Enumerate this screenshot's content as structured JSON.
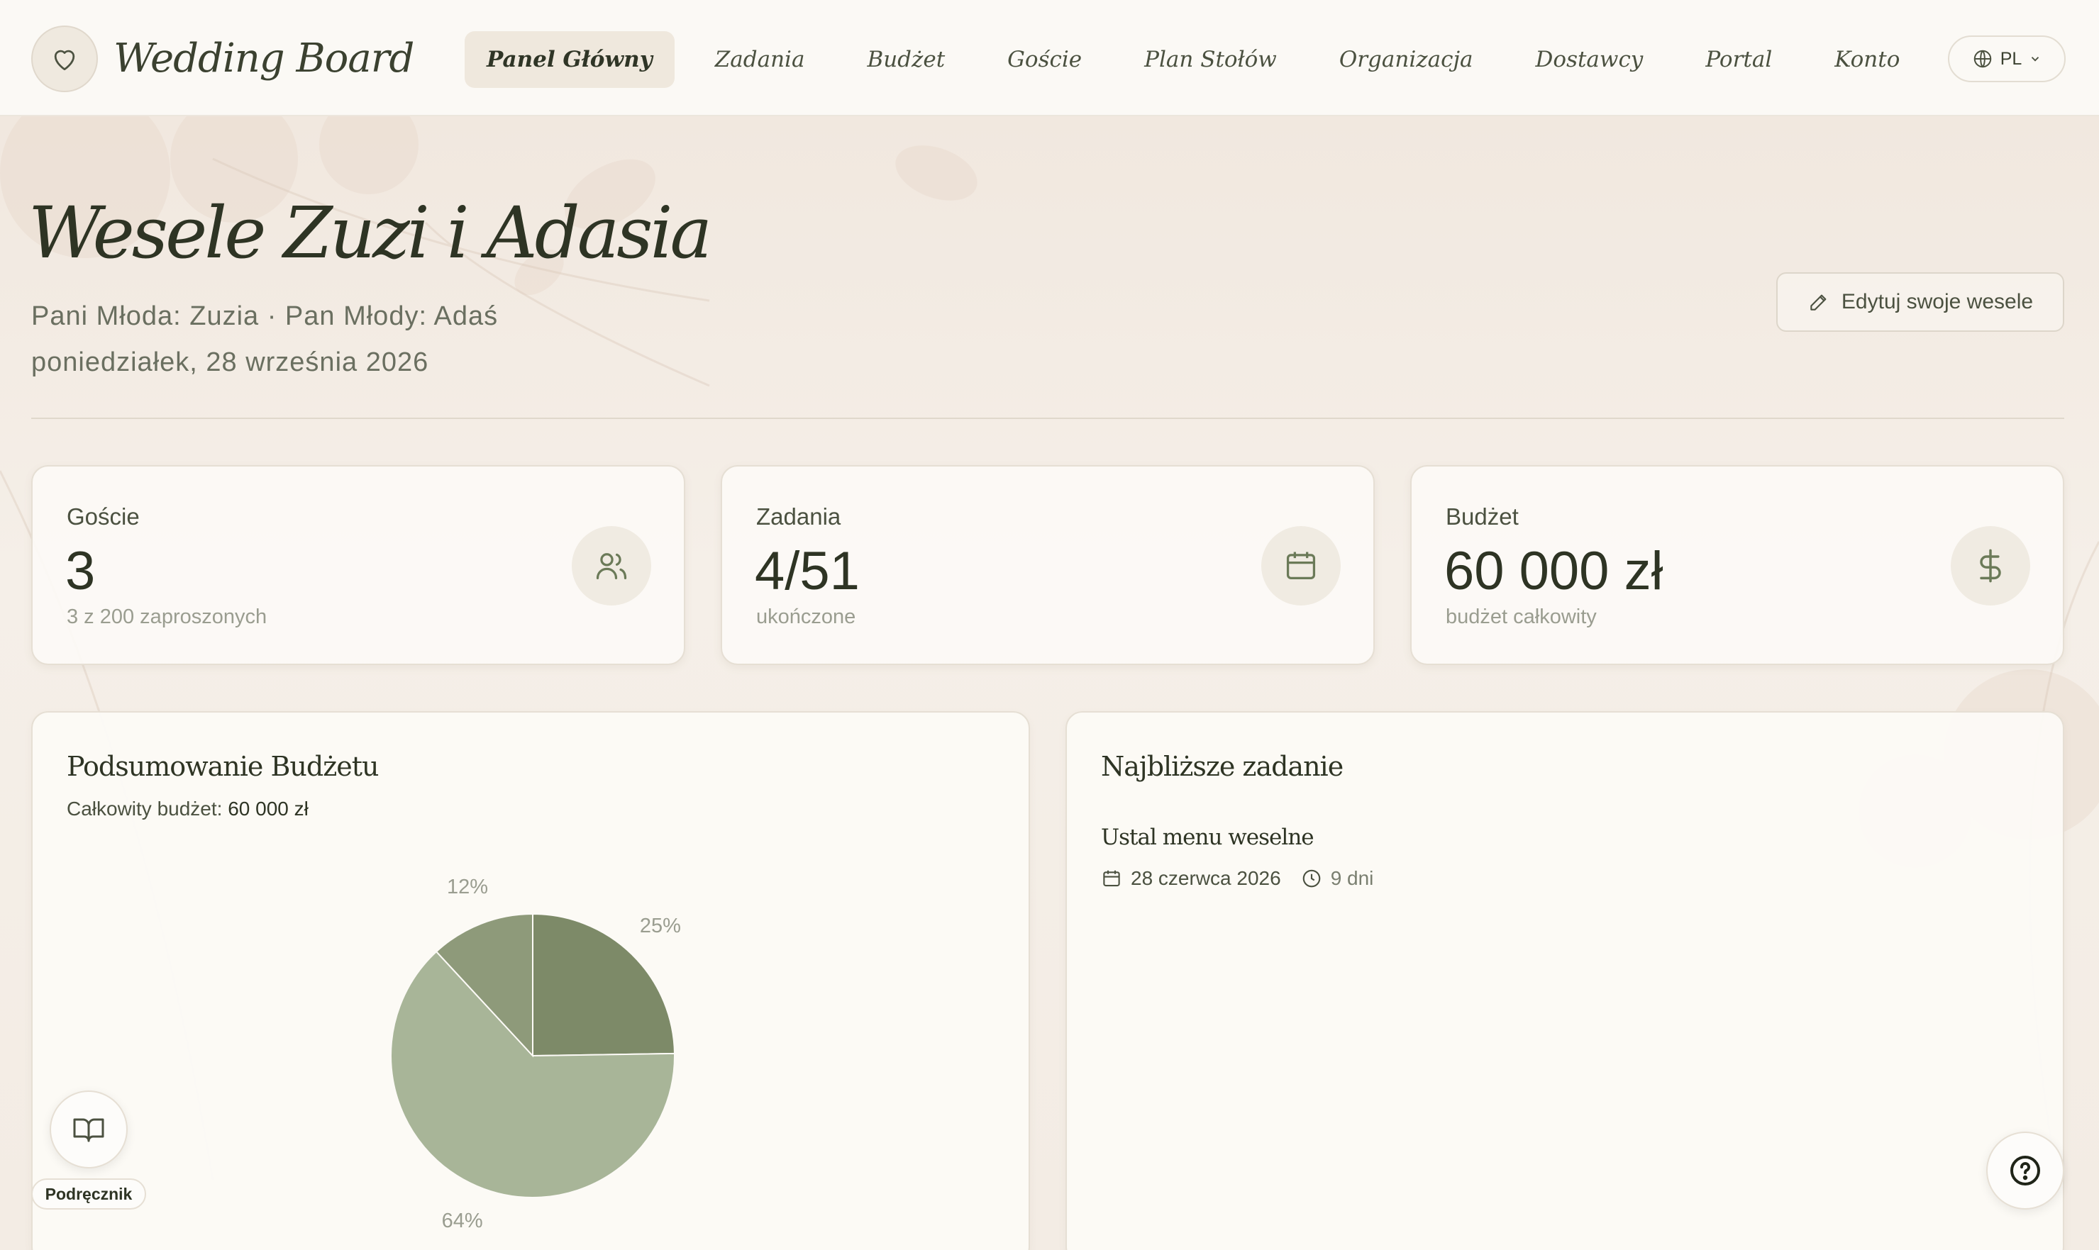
{
  "header": {
    "brand": "Wedding Board",
    "nav": [
      "Panel Główny",
      "Zadania",
      "Budżet",
      "Goście",
      "Plan Stołów",
      "Organizacja",
      "Dostawcy",
      "Portal",
      "Konto"
    ],
    "language": "PL"
  },
  "hero": {
    "title": "Wesele Zuzi i Adasia",
    "couple": "Pani Młoda: Zuzia · Pan Młody: Adaś",
    "date": "poniedziałek, 28 września 2026",
    "edit_label": "Edytuj swoje wesele"
  },
  "stats": [
    {
      "label": "Goście",
      "value": "3",
      "sub": "3 z 200 zaproszonych",
      "icon": "users-icon"
    },
    {
      "label": "Zadania",
      "value": "4/51",
      "sub": "ukończone",
      "icon": "calendar-icon"
    },
    {
      "label": "Budżet",
      "value": "60 000 zł",
      "sub": "budżet całkowity",
      "icon": "dollar-icon"
    }
  ],
  "budget_panel": {
    "title": "Podsumowanie Budżetu",
    "total_label": "Całkowity budżet:",
    "total_value": "60 000 zł"
  },
  "chart_data": {
    "type": "pie",
    "values": [
      25,
      64,
      12
    ],
    "labels": [
      "25%",
      "64%",
      "12%"
    ],
    "colors": [
      "#7d8a68",
      "#a8b598",
      "#8e9a7a"
    ]
  },
  "task_panel": {
    "title": "Najbliższe zadanie",
    "task_name": "Ustal menu weselne",
    "due_date": "28 czerwca 2026",
    "days_left": "9 dni"
  },
  "floating": {
    "handbook_label": "Podręcznik"
  },
  "colors": {
    "accent": "#7d8a68",
    "background": "#f6f1ea",
    "text": "#2e3424"
  }
}
